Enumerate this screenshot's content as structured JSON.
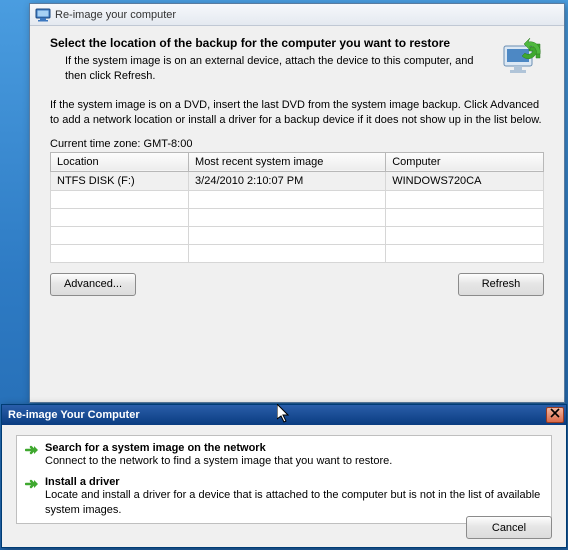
{
  "window1": {
    "title": "Re-image your computer",
    "heading": "Select the location of the backup for the computer you want to restore",
    "subheading": "If the system image is on an external device, attach the device to this computer, and then click Refresh.",
    "instruction2": "If the system image is on a DVD, insert the last DVD from the system image backup. Click Advanced to add a network location or install a driver for a backup device if it does not show up in the list below.",
    "timezone": "Current time zone: GMT-8:00",
    "columns": {
      "location": "Location",
      "most_recent": "Most recent system image",
      "computer": "Computer"
    },
    "rows": [
      {
        "location": "NTFS DISK (F:)",
        "most_recent": "3/24/2010 2:10:07 PM",
        "computer": "WINDOWS720CA"
      }
    ],
    "buttons": {
      "advanced": "Advanced...",
      "refresh": "Refresh"
    }
  },
  "window2": {
    "title": "Re-image Your Computer",
    "options": [
      {
        "title": "Search for a system image on the network",
        "desc": "Connect to the network to find a system image that you want to restore."
      },
      {
        "title": "Install a driver",
        "desc": "Locate and install a driver for a device that is attached to the computer but is not in the list of available system images."
      }
    ],
    "cancel": "Cancel"
  }
}
